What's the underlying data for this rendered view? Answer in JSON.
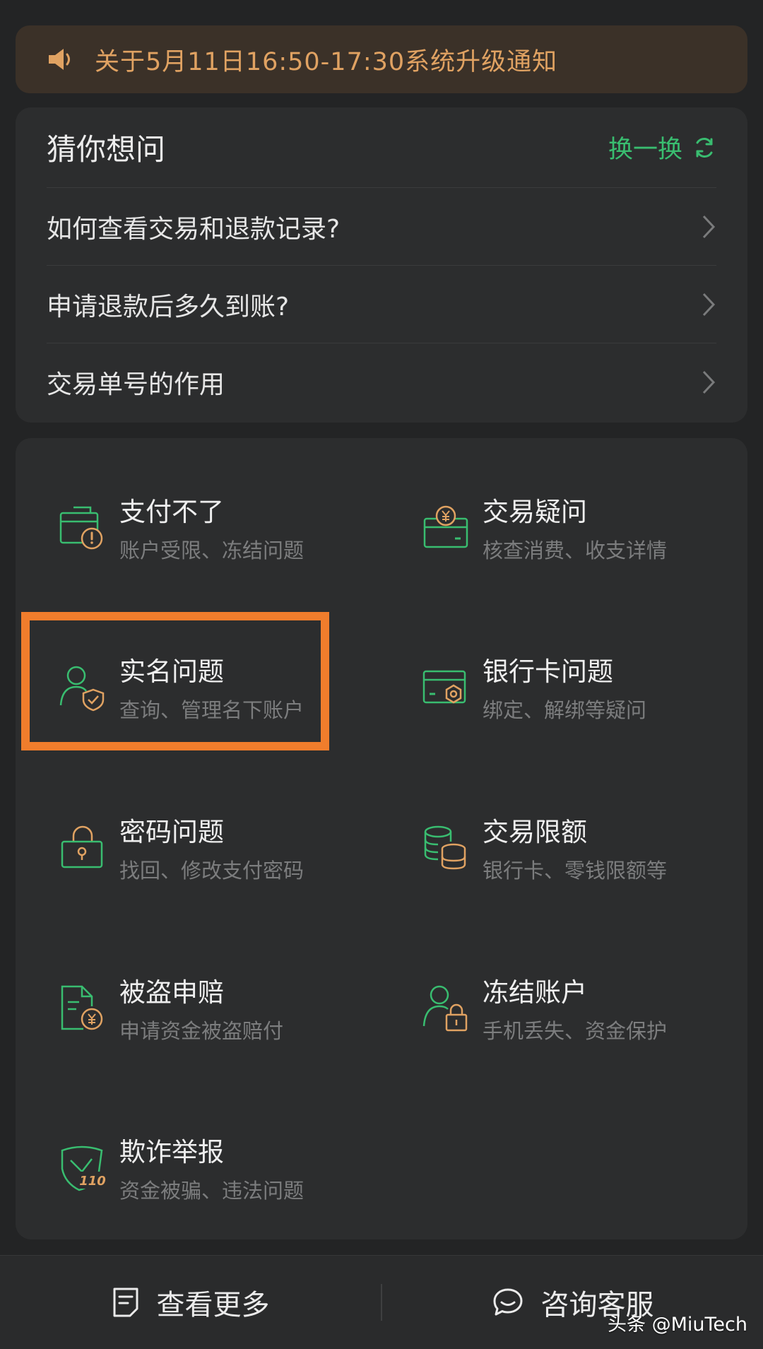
{
  "notice": {
    "text": "关于5月11日16:50-17:30系统升级通知",
    "icon": "speaker-icon"
  },
  "guess": {
    "title": "猜你想问",
    "refresh_label": "换一换",
    "questions": [
      "如何查看交易和退款记录?",
      "申请退款后多久到账?",
      "交易单号的作用"
    ]
  },
  "categories": [
    {
      "title": "支付不了",
      "desc": "账户受限、冻结问题",
      "icon": "wallet-alert-icon"
    },
    {
      "title": "交易疑问",
      "desc": "核查消费、收支详情",
      "icon": "yuan-coin-icon"
    },
    {
      "title": "实名问题",
      "desc": "查询、管理名下账户",
      "icon": "user-shield-icon"
    },
    {
      "title": "银行卡问题",
      "desc": "绑定、解绑等疑问",
      "icon": "bank-card-icon"
    },
    {
      "title": "密码问题",
      "desc": "找回、修改支付密码",
      "icon": "lock-icon"
    },
    {
      "title": "交易限额",
      "desc": "银行卡、零钱限额等",
      "icon": "coins-stack-icon"
    },
    {
      "title": "被盗申赔",
      "desc": "申请资金被盗赔付",
      "icon": "document-yuan-icon"
    },
    {
      "title": "冻结账户",
      "desc": "手机丢失、资金保护",
      "icon": "user-lock-icon"
    },
    {
      "title": "欺诈举报",
      "desc": "资金被骗、违法问题",
      "icon": "police-110-icon",
      "badge": "110"
    }
  ],
  "bottom": {
    "more_label": "查看更多",
    "service_label": "咨询客服"
  },
  "watermark": "头条 @MiuTech",
  "colors": {
    "green": "#39bd70",
    "orange": "#e0a262",
    "highlight": "#f07d2c"
  }
}
